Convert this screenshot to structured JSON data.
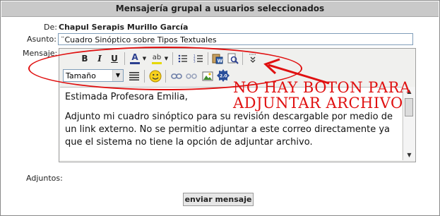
{
  "title": "Mensajería grupal a usuarios seleccionados",
  "from": {
    "label": "De:",
    "value": "Chapul Serapis Murillo García"
  },
  "subject": {
    "label": "Asunto:",
    "value": "¨Cuadro Sinóptico sobre Tipos Textuales"
  },
  "message": {
    "label": "Mensaje:"
  },
  "toolbar": {
    "bold": "B",
    "italic": "I",
    "underline": "U",
    "font_color_glyph": "A",
    "highlight_glyph": "ab",
    "font_size": "Tamaño"
  },
  "body": {
    "paragraphs": [
      "Estimada Profesora Emilia,",
      "Adjunto mi cuadro sinóptico para su revisión descargable por medio de un link externo. No se permitio adjuntar a este correo directamente ya que el sistema no tiene la opción de adjuntar archivo."
    ]
  },
  "attachments": {
    "label": "Adjuntos:"
  },
  "send_button": "enviar mensaje",
  "annotation": {
    "line1": "NO HAY BOTON PARA",
    "line2": "ADJUNTAR ARCHIVO",
    "color": "#e01010"
  }
}
